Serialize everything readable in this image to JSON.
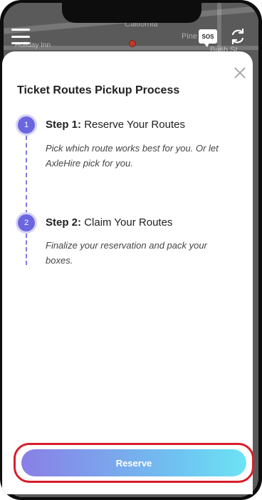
{
  "map": {
    "labels": [
      "California",
      "Pine",
      "Holiday Inn",
      "Bush St"
    ]
  },
  "header": {
    "sos_label": "SOS"
  },
  "modal": {
    "title": "Ticket Routes Pickup Process",
    "steps": [
      {
        "number": "1",
        "prefix": "Step 1:",
        "title": "Reserve Your Routes",
        "description": "Pick which route works best for you. Or let AxleHire pick for you."
      },
      {
        "number": "2",
        "prefix": "Step 2:",
        "title": "Claim Your Routes",
        "description": "Finalize your reservation and pack your boxes."
      }
    ],
    "reserve_label": "Reserve"
  },
  "colors": {
    "step_accent": "#6b66e0",
    "highlight_outline": "#d81e2b"
  }
}
